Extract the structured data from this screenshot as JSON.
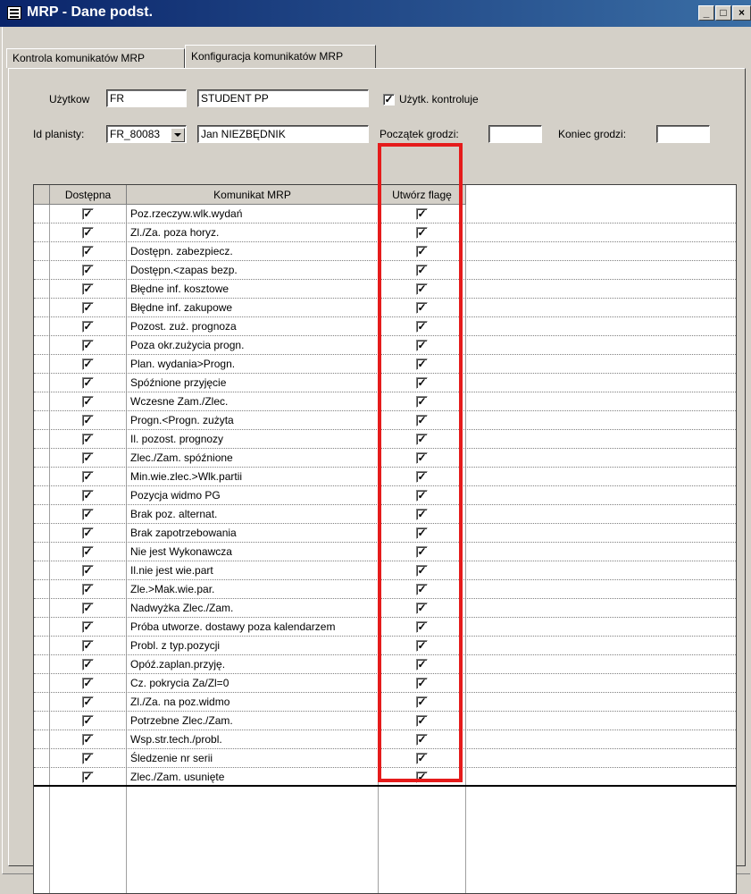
{
  "window": {
    "title": "MRP - Dane podst.",
    "min": "_",
    "max": "□",
    "close": "×"
  },
  "tabs": [
    {
      "label": "Kontrola komunikatów MRP"
    },
    {
      "label": "Konfiguracja komunikatów MRP"
    }
  ],
  "form": {
    "user_label": "Użytkow",
    "user_code": "FR",
    "user_name": "STUDENT PP",
    "user_controls_label": "Użytk. kontroluje",
    "user_controls_checked": true,
    "planner_label": "Id planisty:",
    "planner_id": "FR_80083",
    "planner_name": "Jan NIEZBĘDNIK",
    "fence_start_label": "Początek grodzi:",
    "fence_start": "",
    "fence_end_label": "Koniec grodzi:",
    "fence_end": ""
  },
  "grid": {
    "headers": {
      "available": "Dostępna",
      "message": "Komunikat MRP",
      "flag": "Utwórz flagę"
    },
    "rows": [
      {
        "message": "Poz.rzeczyw.wlk.wydań",
        "available": true,
        "flag": true
      },
      {
        "message": "Zl./Za. poza horyz.",
        "available": true,
        "flag": true
      },
      {
        "message": "Dostępn. zabezpiecz.",
        "available": true,
        "flag": true
      },
      {
        "message": "Dostępn.<zapas bezp.",
        "available": true,
        "flag": true
      },
      {
        "message": "Błędne inf. kosztowe",
        "available": true,
        "flag": true
      },
      {
        "message": "Błędne inf. zakupowe",
        "available": true,
        "flag": true
      },
      {
        "message": "Pozost. zuż. prognoza",
        "available": true,
        "flag": true
      },
      {
        "message": "Poza okr.zużycia progn.",
        "available": true,
        "flag": true
      },
      {
        "message": "Plan. wydania>Progn.",
        "available": true,
        "flag": true
      },
      {
        "message": "Spóźnione przyjęcie",
        "available": true,
        "flag": true
      },
      {
        "message": "Wczesne Zam./Zlec.",
        "available": true,
        "flag": true
      },
      {
        "message": "Progn.<Progn. zużyta",
        "available": true,
        "flag": true
      },
      {
        "message": "Il. pozost. prognozy",
        "available": true,
        "flag": true
      },
      {
        "message": "Zlec./Zam. spóźnione",
        "available": true,
        "flag": true
      },
      {
        "message": "Min.wie.zlec.>Wlk.partii",
        "available": true,
        "flag": true
      },
      {
        "message": "Pozycja widmo PG",
        "available": true,
        "flag": true
      },
      {
        "message": "Brak poz. alternat.",
        "available": true,
        "flag": true
      },
      {
        "message": "Brak zapotrzebowania",
        "available": true,
        "flag": true
      },
      {
        "message": "Nie jest Wykonawcza",
        "available": true,
        "flag": true
      },
      {
        "message": "Il.nie jest wie.part",
        "available": true,
        "flag": true
      },
      {
        "message": "Zle.>Mak.wie.par.",
        "available": true,
        "flag": true
      },
      {
        "message": "Nadwyżka Zlec./Zam.",
        "available": true,
        "flag": true
      },
      {
        "message": "Próba utworze. dostawy poza kalendarzem",
        "available": true,
        "flag": true
      },
      {
        "message": "Probl. z typ.pozycji",
        "available": true,
        "flag": true
      },
      {
        "message": "Opóź.zaplan.przyję.",
        "available": true,
        "flag": true
      },
      {
        "message": "Cz. pokrycia Za/Zl=0",
        "available": true,
        "flag": true
      },
      {
        "message": "Zl./Za. na poz.widmo",
        "available": true,
        "flag": true
      },
      {
        "message": "Potrzebne Zlec./Zam.",
        "available": true,
        "flag": true
      },
      {
        "message": "Wsp.str.tech./probl.",
        "available": true,
        "flag": true
      },
      {
        "message": "Śledzenie nr serii",
        "available": true,
        "flag": true
      },
      {
        "message": "Zlec./Zam. usunięte",
        "available": true,
        "flag": true
      }
    ]
  },
  "highlight_color": "#e51b1b"
}
